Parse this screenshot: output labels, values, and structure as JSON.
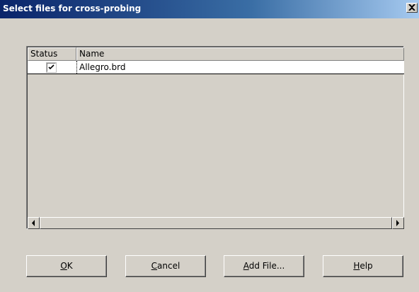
{
  "window": {
    "title": "Select files for cross-probing",
    "close_glyph": "✕"
  },
  "table": {
    "columns": [
      "Status",
      "Name"
    ],
    "rows": [
      {
        "checked": true,
        "name": "Allegro.brd"
      }
    ]
  },
  "buttons": {
    "ok": {
      "mnemonic": "O",
      "rest": "K"
    },
    "cancel": {
      "mnemonic": "C",
      "rest": "ancel"
    },
    "add_file": {
      "mnemonic": "A",
      "rest": "dd File..."
    },
    "help": {
      "mnemonic": "H",
      "rest": "elp"
    }
  },
  "icons": {
    "close": "close-icon",
    "check": "checkmark-icon",
    "scroll_left": "arrow-left-icon",
    "scroll_right": "arrow-right-icon"
  }
}
